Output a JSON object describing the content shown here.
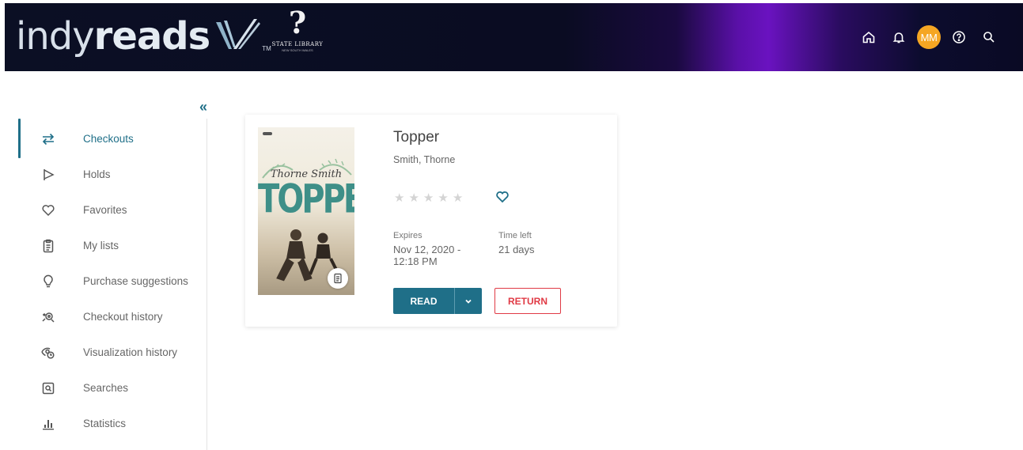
{
  "header": {
    "logo_light": "indy",
    "logo_bold": "reads",
    "logo_tm": "TM",
    "partner_name": "STATE LIBRARY",
    "partner_sub": "NEW SOUTH WALES",
    "avatar_initials": "MM",
    "icons": [
      "home-icon",
      "bell-icon",
      "avatar",
      "help-icon",
      "search-icon"
    ],
    "bg_color": "#0b0f24",
    "accent_color": "#6a12c0"
  },
  "sidebar": {
    "collapse_label": "«",
    "items": [
      {
        "label": "Checkouts",
        "icon": "swap-arrows-icon",
        "active": true
      },
      {
        "label": "Holds",
        "icon": "flag-icon",
        "active": false
      },
      {
        "label": "Favorites",
        "icon": "heart-icon",
        "active": false
      },
      {
        "label": "My lists",
        "icon": "clipboard-icon",
        "active": false
      },
      {
        "label": "Purchase suggestions",
        "icon": "lightbulb-icon",
        "active": false
      },
      {
        "label": "Checkout history",
        "icon": "history-icon",
        "active": false
      },
      {
        "label": "Visualization history",
        "icon": "eye-clock-icon",
        "active": false
      },
      {
        "label": "Searches",
        "icon": "saved-search-icon",
        "active": false
      },
      {
        "label": "Statistics",
        "icon": "bar-chart-icon",
        "active": false
      }
    ],
    "accent_color": "#1f6f88"
  },
  "checkout": {
    "cover": {
      "author": "Thorne Smith",
      "title": "TOPPER"
    },
    "title": "Topper",
    "author": "Smith, Thorne",
    "rating": 0,
    "rating_max": 5,
    "expires_label": "Expires",
    "expires_line1": "Nov 12, 2020 -",
    "expires_line2": "12:18 PM",
    "time_left_label": "Time left",
    "time_left_value": "21 days",
    "read_label": "READ",
    "return_label": "RETURN",
    "read_color": "#1f6f88",
    "return_color": "#e03a45"
  }
}
